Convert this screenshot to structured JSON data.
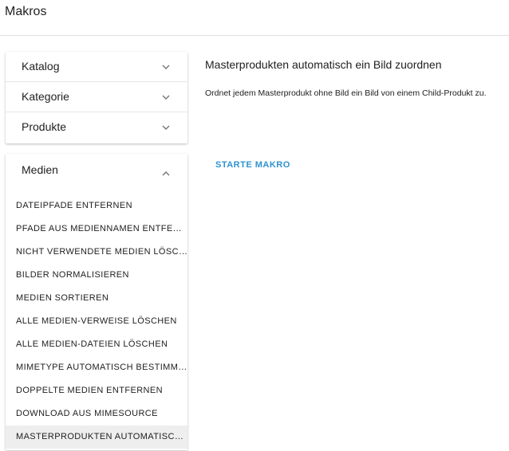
{
  "header": {
    "title": "Makros"
  },
  "accordion": [
    {
      "label": "Katalog",
      "icon": "chevron-down-icon"
    },
    {
      "label": "Kategorie",
      "icon": "chevron-down-icon"
    },
    {
      "label": "Produkte",
      "icon": "chevron-down-icon"
    }
  ],
  "media": {
    "label": "Medien",
    "icon": "chevron-up-icon",
    "items": [
      "DATEIPFADE ENTFERNEN",
      "PFADE AUS MEDIENNAMEN ENTFERNEN",
      "NICHT VERWENDETE MEDIEN LÖSCHEN",
      "BILDER NORMALISIEREN",
      "MEDIEN SORTIEREN",
      "ALLE MEDIEN-VERWEISE LÖSCHEN",
      "ALLE MEDIEN-DATEIEN LÖSCHEN",
      "MIMETYPE AUTOMATISCH BESTIMMEN",
      "DOPPELTE MEDIEN ENTFERNEN",
      "DOWNLOAD AUS MIMESOURCE",
      "MASTERPRODUKTEN AUTOMATISCH EIN BILD ZUORDNEN"
    ],
    "active_index": 10
  },
  "main": {
    "title": "Masterprodukten automatisch ein Bild zuordnen",
    "description": "Ordnet jedem Masterprodukt ohne Bild ein Bild von einem Child-Produkt zu.",
    "start_label": "STARTE MAKRO"
  },
  "colors": {
    "accent": "#2f93d1",
    "active_bg": "#eeeeee",
    "divider": "#e0e0e0"
  }
}
